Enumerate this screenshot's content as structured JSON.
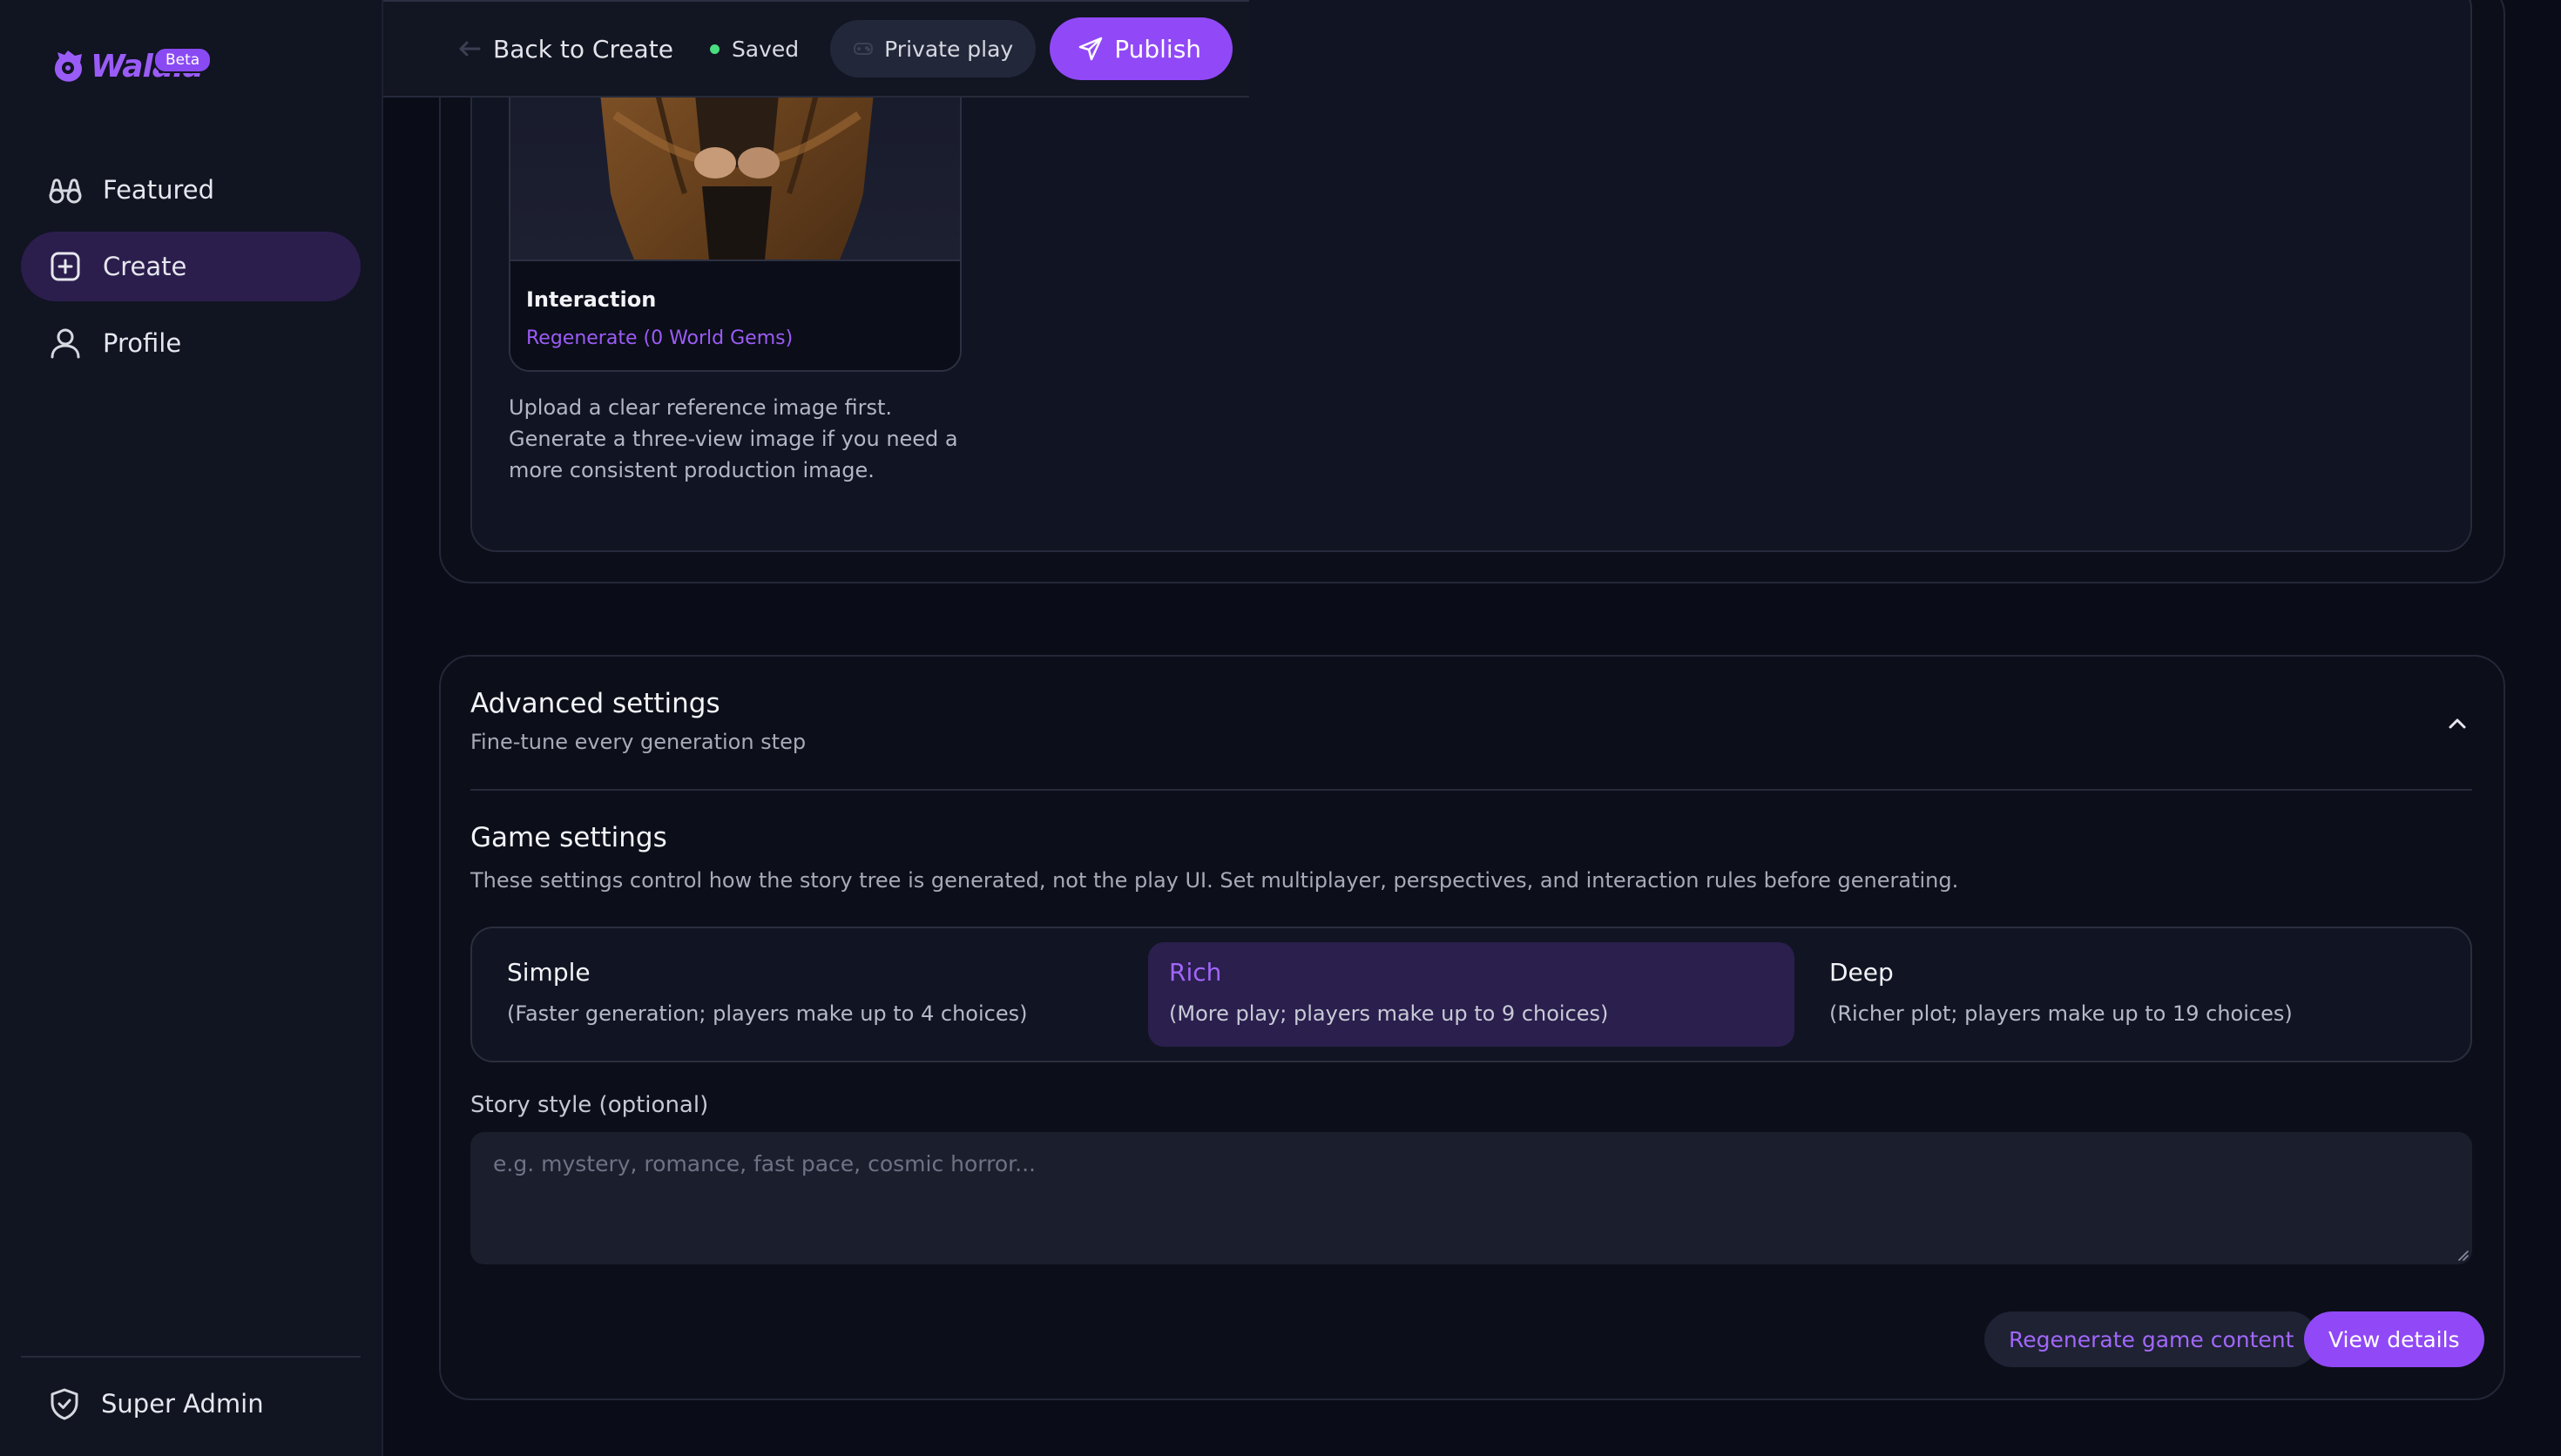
{
  "app": {
    "logo_text": "Walala",
    "beta_label": "Beta"
  },
  "sidebar": {
    "items": [
      {
        "label": "Featured",
        "icon": "binoculars-icon",
        "active": false
      },
      {
        "label": "Create",
        "icon": "plus-square-icon",
        "active": true
      },
      {
        "label": "Profile",
        "icon": "user-icon",
        "active": false
      }
    ],
    "footer": {
      "label": "Super Admin",
      "icon": "shield-check-icon"
    }
  },
  "topbar": {
    "back_label": "Back to Create",
    "saved_label": "Saved",
    "private_label": "Private play",
    "publish_label": "Publish"
  },
  "image_card": {
    "title": "Interaction",
    "regenerate_label": "Regenerate (0 World Gems)",
    "hint": "Upload a clear reference image first. Generate a three-view image if you need a more consistent production image."
  },
  "advanced": {
    "title": "Advanced settings",
    "subtitle": "Fine-tune every generation step",
    "game_settings_title": "Game settings",
    "game_settings_desc": "These settings control how the story tree is generated, not the play UI. Set multiplayer, perspectives, and interaction rules before generating.",
    "modes": [
      {
        "name": "Simple",
        "desc": "(Faster generation; players make up to 4 choices)",
        "selected": false
      },
      {
        "name": "Rich",
        "desc": "(More play; players make up to 9 choices)",
        "selected": true
      },
      {
        "name": "Deep",
        "desc": "(Richer plot; players make up to 19 choices)",
        "selected": false
      }
    ],
    "story_style_label": "Story style (optional)",
    "story_style_placeholder": "e.g. mystery, romance, fast pace, cosmic horror...",
    "story_style_value": "",
    "regenerate_label": "Regenerate game content",
    "view_details_label": "View details"
  },
  "colors": {
    "accent": "#9149f7",
    "accent_text": "#a267fa",
    "background": "#0a0c17",
    "sidebar": "#111421",
    "selected_mode": "#2a1f4d",
    "saved_dot": "#4ade80"
  }
}
